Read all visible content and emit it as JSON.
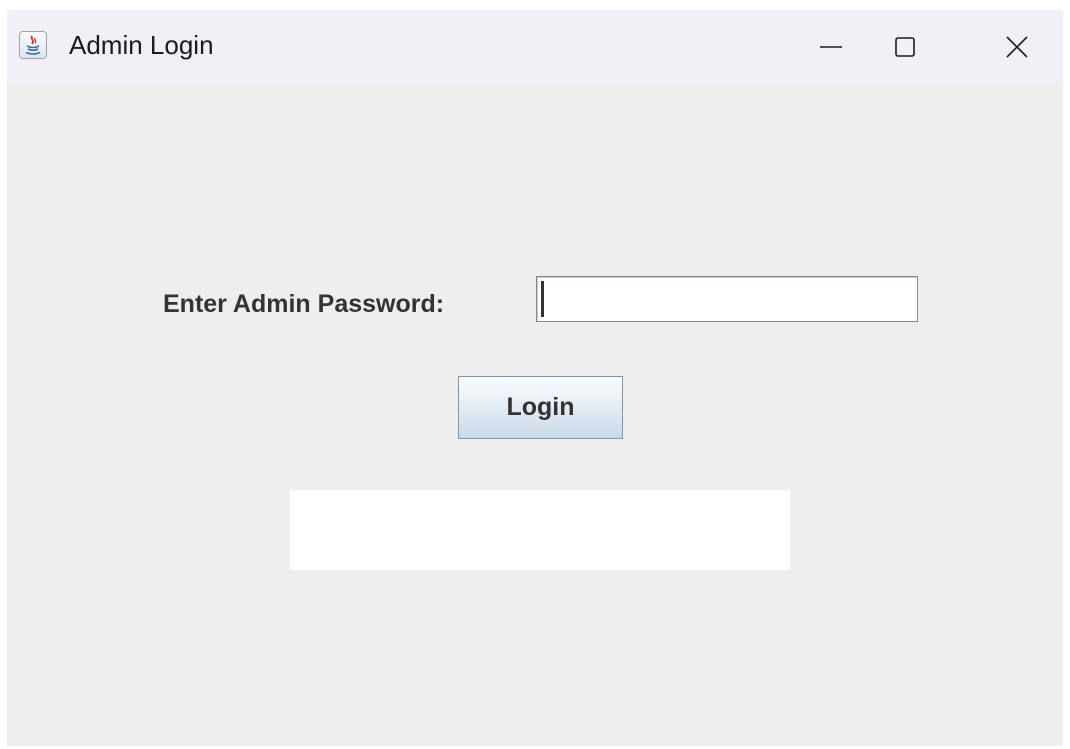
{
  "window": {
    "title": "Admin Login",
    "controls": {
      "minimize_icon": "minimize-icon",
      "maximize_icon": "maximize-icon",
      "close_icon": "close-icon"
    }
  },
  "form": {
    "password_label": "Enter Admin Password:",
    "password_value": "",
    "login_button_label": "Login",
    "message_text": ""
  },
  "colors": {
    "window_background": "#eeeeee",
    "titlebar_background": "#f3eff7",
    "text": "#333333",
    "button_border": "#7f95ab"
  }
}
